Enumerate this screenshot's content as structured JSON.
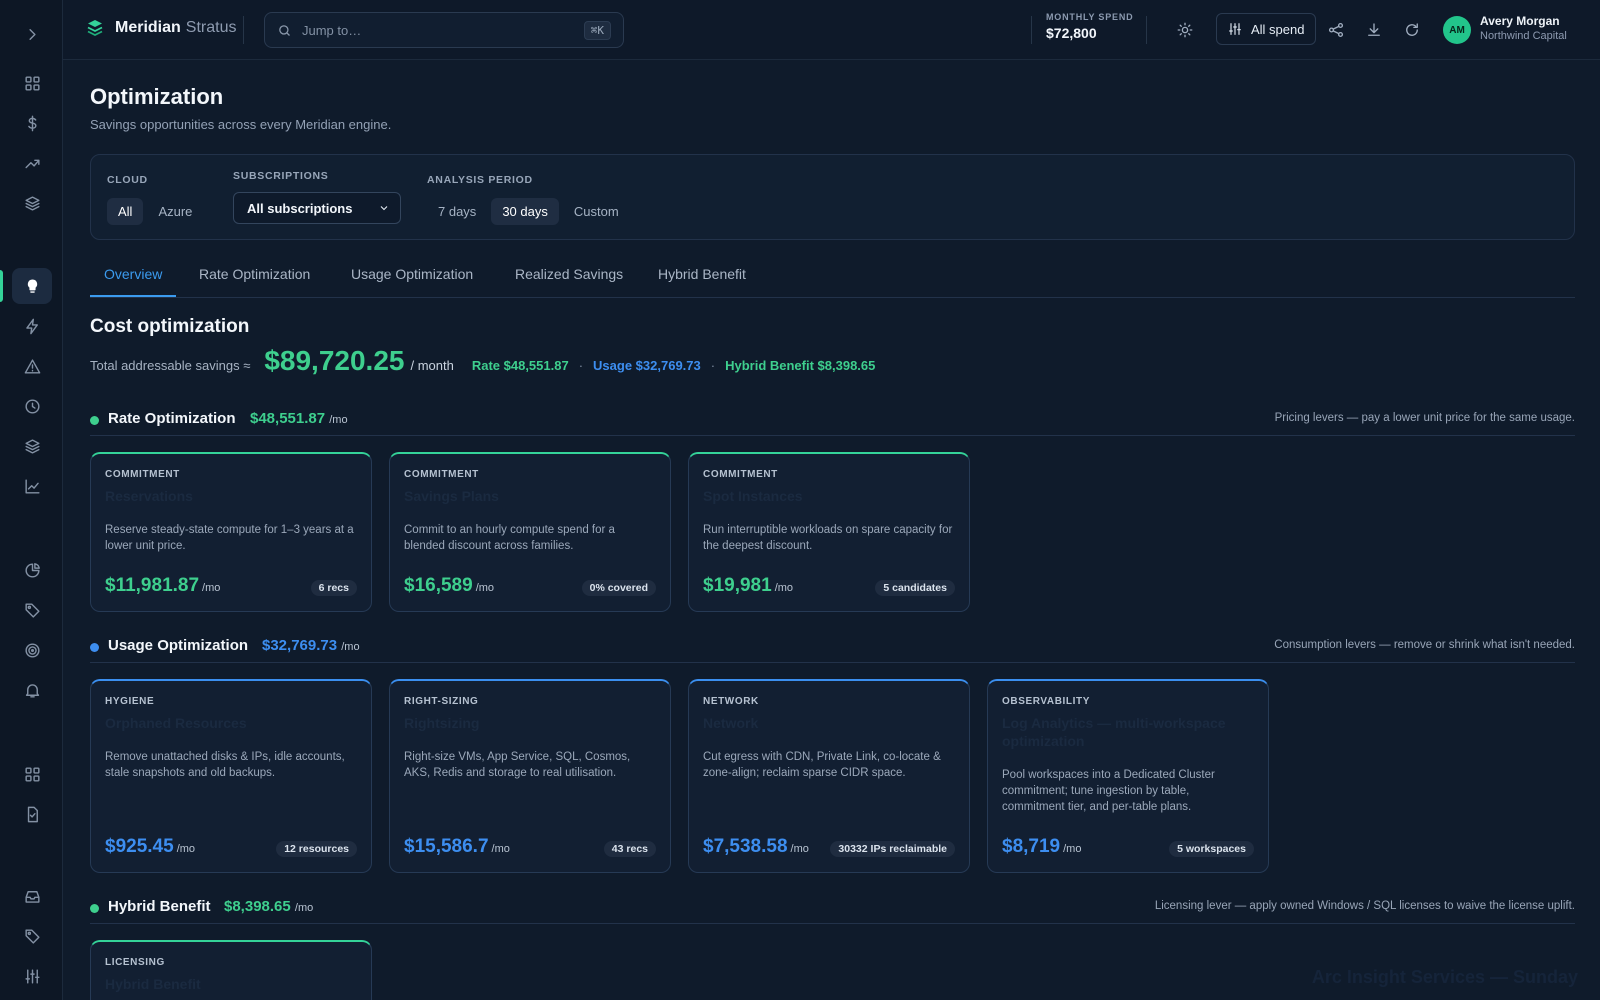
{
  "brand": {
    "name": "Meridian",
    "product": "Stratus"
  },
  "search": {
    "placeholder": "Jump to…",
    "shortcut": "⌘K"
  },
  "spend": {
    "label": "MONTHLY SPEND",
    "value": "$72,800"
  },
  "toolbar": {
    "filter_label": "All spend"
  },
  "user": {
    "initials": "AM",
    "name": "Avery Morgan",
    "org": "Northwind Capital"
  },
  "page": {
    "title": "Optimization",
    "subtitle": "Savings opportunities across every Meridian engine."
  },
  "filters": {
    "cloud": {
      "label": "CLOUD",
      "options": [
        "All",
        "Azure"
      ],
      "selected": "All"
    },
    "subscriptions": {
      "label": "SUBSCRIPTIONS",
      "value": "All subscriptions"
    },
    "period": {
      "label": "ANALYSIS PERIOD",
      "options": [
        "7 days",
        "30 days",
        "Custom"
      ],
      "selected": "30 days"
    }
  },
  "tabs": [
    {
      "label": "Overview",
      "active": true
    },
    {
      "label": "Rate Optimization"
    },
    {
      "label": "Usage Optimization"
    },
    {
      "label": "Realized Savings"
    },
    {
      "label": "Hybrid Benefit"
    }
  ],
  "summary": {
    "title": "Cost optimization",
    "total_label": "Total addressable savings ≈",
    "total_value": "$89,720.25",
    "per_month": "/ month",
    "rate": "Rate $48,551.87",
    "usage": "Usage $32,769.73",
    "hybrid": "Hybrid Benefit $8,398.65",
    "separator": "·"
  },
  "groups": {
    "rate": {
      "name": "Rate Optimization",
      "amount": "$48,551.87",
      "unit": "/mo",
      "note": "Pricing levers — pay a lower unit price for the same usage.",
      "color": "#3ecf8e",
      "cards": [
        {
          "kicker": "COMMITMENT",
          "title": "Reservations",
          "desc": "Reserve steady-state compute for 1–3 years at a lower unit price.",
          "amount": "$11,981.87",
          "unit": "/mo",
          "badge": "6 recs"
        },
        {
          "kicker": "COMMITMENT",
          "title": "Savings Plans",
          "desc": "Commit to an hourly compute spend for a blended discount across families.",
          "amount": "$16,589",
          "unit": "/mo",
          "badge": "0% covered"
        },
        {
          "kicker": "COMMITMENT",
          "title": "Spot Instances",
          "desc": "Run interruptible workloads on spare capacity for the deepest discount.",
          "amount": "$19,981",
          "unit": "/mo",
          "badge": "5 candidates"
        }
      ]
    },
    "usage": {
      "name": "Usage Optimization",
      "amount": "$32,769.73",
      "unit": "/mo",
      "note": "Consumption levers — remove or shrink what isn't needed.",
      "color": "#3d8ef0",
      "cards": [
        {
          "kicker": "HYGIENE",
          "title": "Orphaned Resources",
          "desc": "Remove unattached disks & IPs, idle accounts, stale snapshots and old backups.",
          "amount": "$925.45",
          "unit": "/mo",
          "badge": "12 resources"
        },
        {
          "kicker": "RIGHT-SIZING",
          "title": "Rightsizing",
          "desc": "Right-size VMs, App Service, SQL, Cosmos, AKS, Redis and storage to real utilisation.",
          "amount": "$15,586.7",
          "unit": "/mo",
          "badge": "43 recs"
        },
        {
          "kicker": "NETWORK",
          "title": "Network",
          "desc": "Cut egress with CDN, Private Link, co-locate & zone-align; reclaim sparse CIDR space.",
          "amount": "$7,538.58",
          "unit": "/mo",
          "badge": "30332 IPs reclaimable"
        },
        {
          "kicker": "OBSERVABILITY",
          "title": "Log Analytics — multi-workspace optimization",
          "desc": "Pool workspaces into a Dedicated Cluster commitment; tune ingestion by table, commitment tier, and per-table plans.",
          "amount": "$8,719",
          "unit": "/mo",
          "badge": "5 workspaces"
        }
      ]
    },
    "hybrid": {
      "name": "Hybrid Benefit",
      "amount": "$8,398.65",
      "unit": "/mo",
      "note": "Licensing lever — apply owned Windows / SQL licenses to waive the license uplift.",
      "color": "#3ecf8e",
      "cards": [
        {
          "kicker": "LICENSING",
          "title": "Hybrid Benefit"
        }
      ]
    }
  },
  "watermark": "Arc Insight Services — Sunday"
}
